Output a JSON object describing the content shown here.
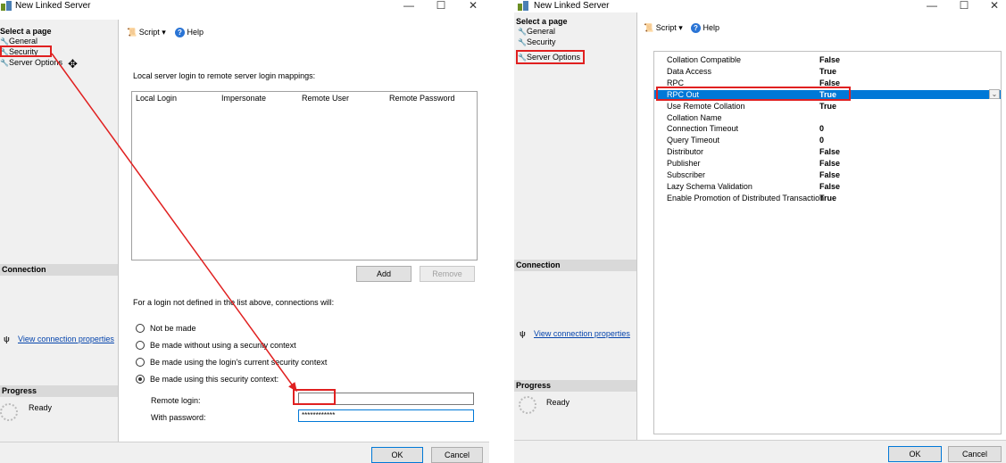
{
  "left": {
    "title": "New Linked Server",
    "window_controls": {
      "minimize": "—",
      "maximize": "☐",
      "close": "✕"
    },
    "sidebar": {
      "select_header": "Select a page",
      "items": [
        "General",
        "Security",
        "Server Options"
      ],
      "connection_header": "Connection",
      "view_connection_link": "View connection properties",
      "progress_header": "Progress",
      "ready": "Ready"
    },
    "toolbar": {
      "script": "Script",
      "dropdown": "▾",
      "help": "Help"
    },
    "mappings_label": "Local server login to remote server login mappings:",
    "grid_headers": [
      "Local Login",
      "Impersonate",
      "Remote User",
      "Remote Password"
    ],
    "add_button": "Add",
    "remove_button": "Remove",
    "undefined_login_label": "For a login not defined in the list above, connections will:",
    "radio_options": [
      "Not be made",
      "Be made without using a security context",
      "Be made using the login's current security context",
      "Be made using this security context:"
    ],
    "remote_login_label": "Remote login:",
    "remote_login_value": "",
    "password_label": "With password:",
    "password_value": "************",
    "ok_button": "OK",
    "cancel_button": "Cancel"
  },
  "right": {
    "title": "New Linked Server",
    "window_controls": {
      "minimize": "—",
      "maximize": "☐",
      "close": "✕"
    },
    "sidebar": {
      "select_header": "Select a page",
      "items": [
        "General",
        "Security",
        "Server Options"
      ],
      "connection_header": "Connection",
      "view_connection_link": "View connection properties",
      "progress_header": "Progress",
      "ready": "Ready"
    },
    "toolbar": {
      "script": "Script",
      "dropdown": "▾",
      "help": "Help"
    },
    "properties": [
      {
        "name": "Collation Compatible",
        "value": "False"
      },
      {
        "name": "Data Access",
        "value": "True"
      },
      {
        "name": "RPC",
        "value": "False"
      },
      {
        "name": "RPC Out",
        "value": "True"
      },
      {
        "name": "Use Remote Collation",
        "value": "True"
      },
      {
        "name": "Collation Name",
        "value": ""
      },
      {
        "name": "Connection Timeout",
        "value": "0"
      },
      {
        "name": "Query Timeout",
        "value": "0"
      },
      {
        "name": "Distributor",
        "value": "False"
      },
      {
        "name": "Publisher",
        "value": "False"
      },
      {
        "name": "Subscriber",
        "value": "False"
      },
      {
        "name": "Lazy Schema Validation",
        "value": "False"
      },
      {
        "name": "Enable Promotion of Distributed Transaction",
        "value": "True"
      }
    ],
    "ok_button": "OK",
    "cancel_button": "Cancel"
  },
  "icons": {
    "wrench": "wrench-icon",
    "connection": "connection-icon",
    "spinner": "progress-spinner-icon"
  },
  "colors": {
    "annotation_red": "#e02020",
    "selection_blue": "#0078d7",
    "link_blue": "#0645ad"
  }
}
